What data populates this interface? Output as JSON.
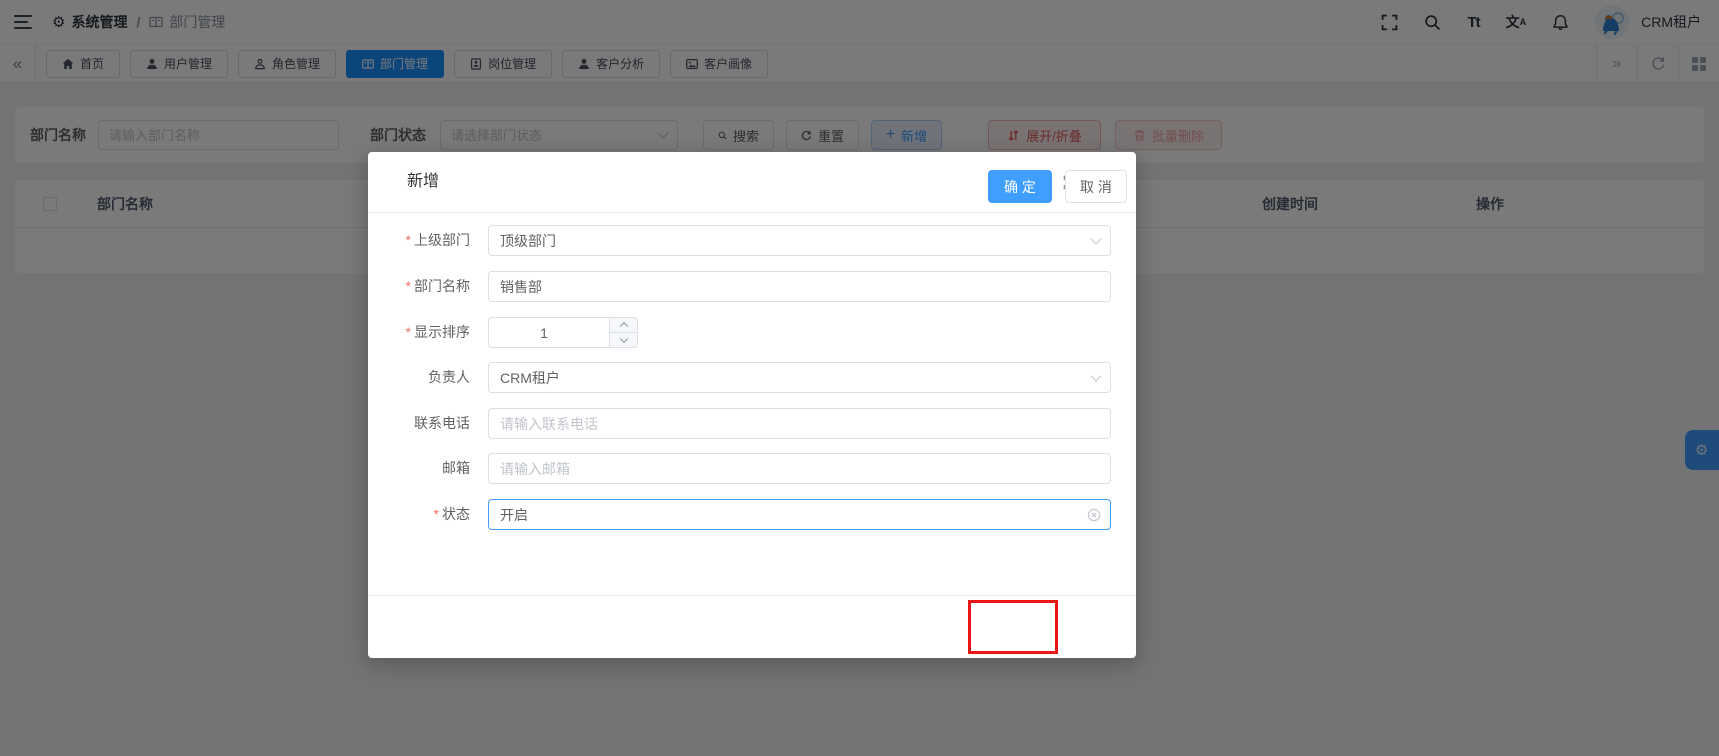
{
  "topbar": {
    "breadcrumb": {
      "level1": "系统管理",
      "separator": "/",
      "level2": "部门管理"
    },
    "font_size_icon_text": "Tt",
    "translate_icon_text": "文",
    "translate_icon_sub": "A",
    "username": "CRM租户"
  },
  "tabbar": {
    "collapse_left_glyph": "«",
    "expand_right_glyph": "»",
    "tabs": [
      {
        "label": "首页",
        "active": false
      },
      {
        "label": "用户管理",
        "active": false
      },
      {
        "label": "角色管理",
        "active": false
      },
      {
        "label": "部门管理",
        "active": true
      },
      {
        "label": "岗位管理",
        "active": false
      },
      {
        "label": "客户分析",
        "active": false
      },
      {
        "label": "客户画像",
        "active": false
      }
    ]
  },
  "filter": {
    "dept_name_label": "部门名称",
    "dept_name_placeholder": "请输入部门名称",
    "dept_status_label": "部门状态",
    "dept_status_placeholder": "请选择部门状态",
    "buttons": {
      "search": "搜索",
      "reset": "重置",
      "add": "新增",
      "add_plus_glyph": "+",
      "expand_collapse": "展开/折叠",
      "batch_delete": "批量删除"
    }
  },
  "table": {
    "columns": [
      "部门名称",
      "创建时间",
      "操作"
    ]
  },
  "dialog": {
    "title": "新增",
    "required_mark": "*",
    "fields": [
      {
        "label": "上级部门",
        "required": true,
        "type": "select",
        "value": "顶级部门"
      },
      {
        "label": "部门名称",
        "required": true,
        "type": "input",
        "value": "销售部"
      },
      {
        "label": "显示排序",
        "required": true,
        "type": "number",
        "value": "1"
      },
      {
        "label": "负责人",
        "required": false,
        "type": "select",
        "value": "CRM租户"
      },
      {
        "label": "联系电话",
        "required": false,
        "type": "input",
        "placeholder": "请输入联系电话"
      },
      {
        "label": "邮箱",
        "required": false,
        "type": "input",
        "placeholder": "请输入邮箱"
      },
      {
        "label": "状态",
        "required": true,
        "type": "select",
        "value": "开启",
        "focused": true,
        "clearable": true
      }
    ],
    "confirm_label": "确 定",
    "cancel_label": "取 消"
  },
  "colors": {
    "primary": "#409eff",
    "tab_active": "#1890ff",
    "danger": "#f56c6c",
    "annotation_highlight": "#ea1616",
    "overlay": "rgba(0,0,0,0.52)"
  }
}
